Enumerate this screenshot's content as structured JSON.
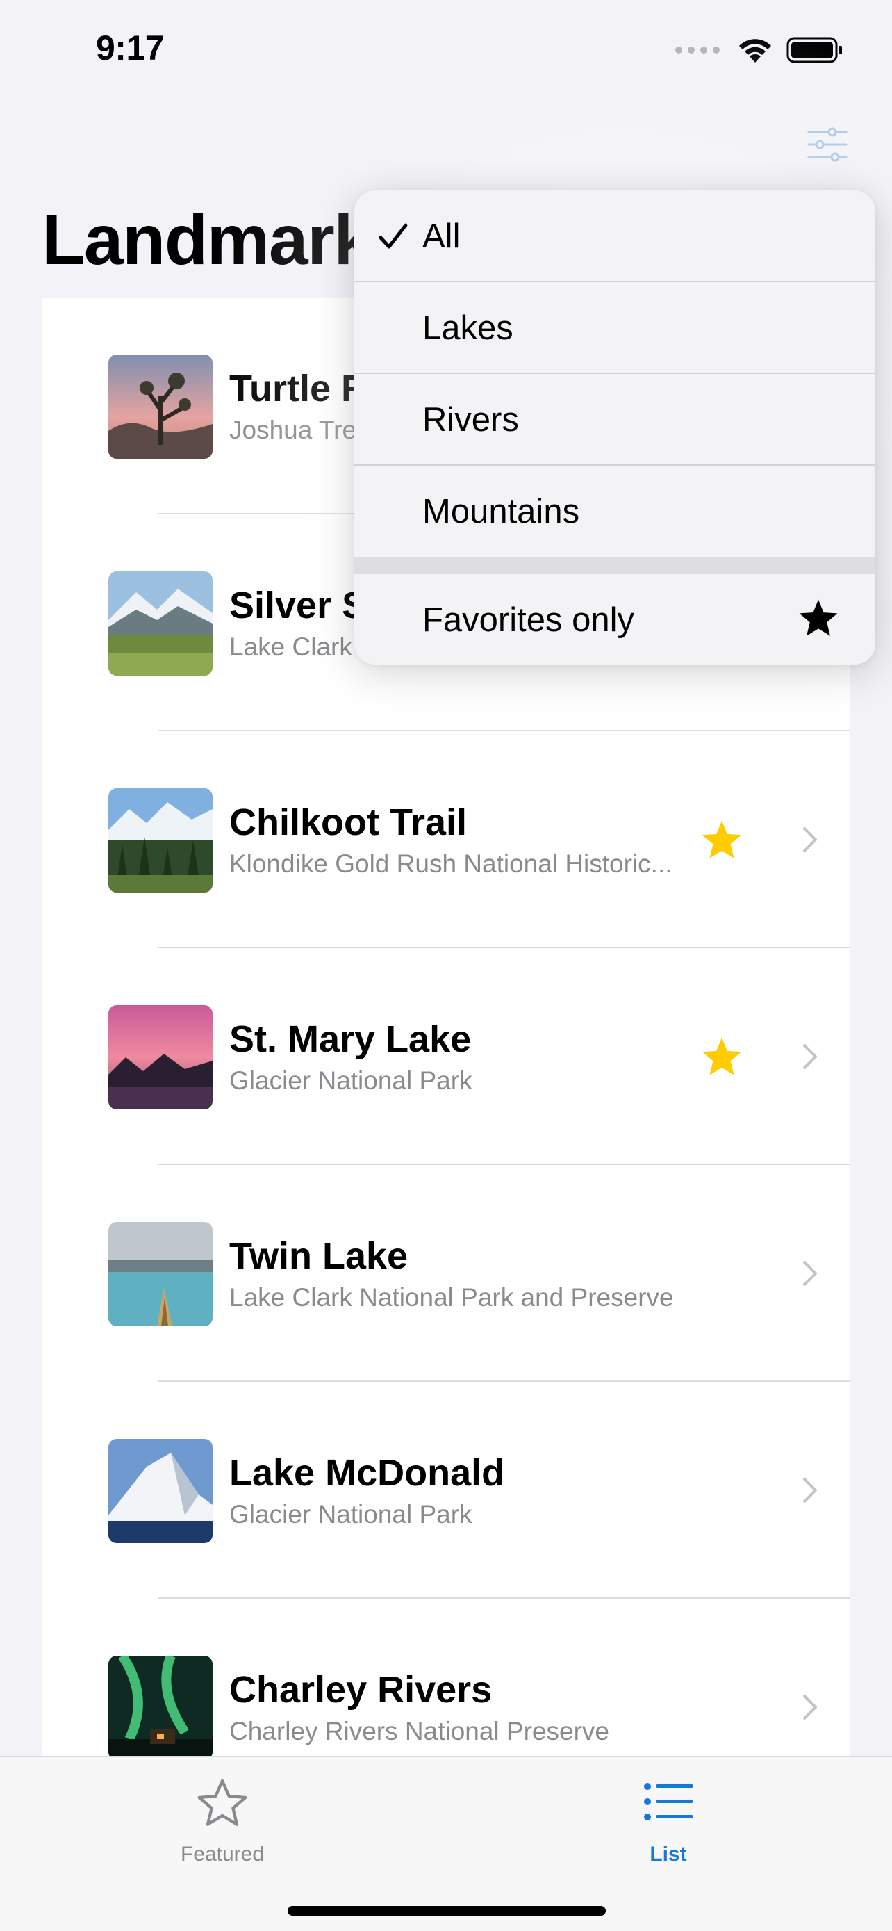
{
  "status_bar": {
    "time": "9:17"
  },
  "header": {
    "title": "Landmarks",
    "filter_icon": "slider-horizontal-icon"
  },
  "list": [
    {
      "name": "Turtle Rock",
      "park": "Joshua Tree National Park",
      "favorite": false,
      "thumb": "desert"
    },
    {
      "name": "Silver Salmon Creek",
      "park": "Lake Clark National Park and Preserve",
      "favorite": false,
      "thumb": "meadow"
    },
    {
      "name": "Chilkoot Trail",
      "park": "Klondike Gold Rush National Historic...",
      "favorite": true,
      "thumb": "forest"
    },
    {
      "name": "St. Mary Lake",
      "park": "Glacier National Park",
      "favorite": true,
      "thumb": "sunset"
    },
    {
      "name": "Twin Lake",
      "park": "Lake Clark National Park and Preserve",
      "favorite": false,
      "thumb": "lake"
    },
    {
      "name": "Lake McDonald",
      "park": "Glacier National Park",
      "favorite": false,
      "thumb": "snowpeak"
    },
    {
      "name": "Charley Rivers",
      "park": "Charley Rivers National Preserve",
      "favorite": false,
      "thumb": "aurora"
    }
  ],
  "menu": {
    "items": [
      {
        "label": "All",
        "checked": true
      },
      {
        "label": "Lakes",
        "checked": false
      },
      {
        "label": "Rivers",
        "checked": false
      },
      {
        "label": "Mountains",
        "checked": false
      }
    ],
    "favorites_label": "Favorites only"
  },
  "tabs": [
    {
      "label": "Featured",
      "icon": "star-outline-icon",
      "selected": false
    },
    {
      "label": "List",
      "icon": "list-bullet-icon",
      "selected": true
    }
  ],
  "colors": {
    "accent": "#1479d9",
    "favorite_star": "#ffcc00",
    "background": "#f2f2f7",
    "secondary_text": "#8a8a8e"
  }
}
